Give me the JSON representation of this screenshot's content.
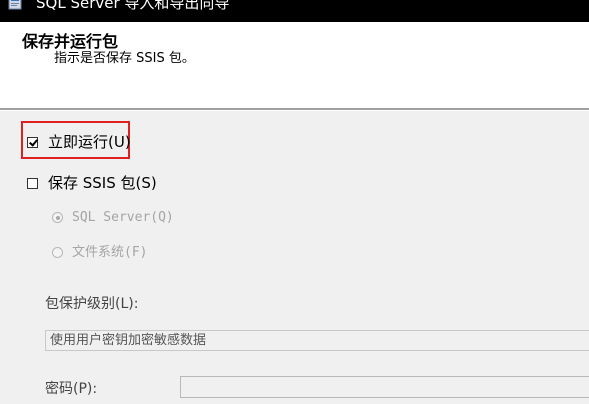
{
  "window": {
    "title": "SQL Server 导入和导出向导",
    "icon": "wizard-app-icon"
  },
  "header": {
    "title": "保存并运行包",
    "subtitle": "指示是否保存 SSIS 包。"
  },
  "options": {
    "run_immediately": {
      "label": "立即运行(U)",
      "checked": true
    },
    "save_ssis": {
      "label": "保存 SSIS 包(S)",
      "checked": false
    },
    "sql_server": {
      "label": "SQL Server(Q)",
      "selected": true,
      "enabled": false
    },
    "file_system": {
      "label": "文件系统(F)",
      "selected": false,
      "enabled": false
    }
  },
  "protection": {
    "label": "包保护级别(L):",
    "value": "使用用户密钥加密敏感数据"
  },
  "password": {
    "label": "密码(P):",
    "value": ""
  },
  "colors": {
    "highlight": "#e02020",
    "titlebar": "#000000"
  }
}
